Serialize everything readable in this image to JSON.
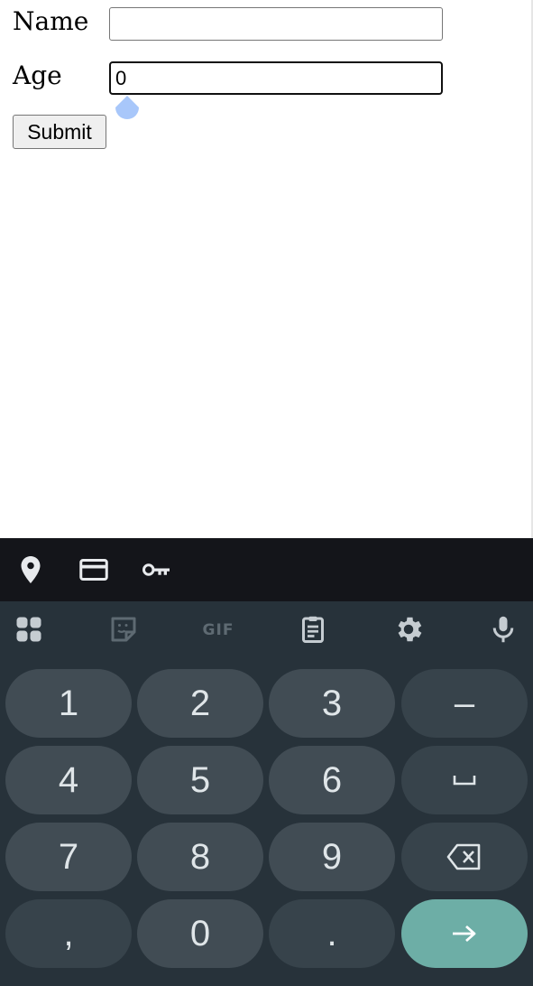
{
  "form": {
    "name_label": "Name",
    "name_value": "",
    "age_label": "Age",
    "age_value": "0",
    "submit_label": "Submit"
  },
  "autofill_bar": {
    "icons": [
      "location-pin-icon",
      "credit-card-icon",
      "key-icon"
    ]
  },
  "keyboard_toolbar": {
    "icons": [
      "apps-grid-icon",
      "sticker-icon",
      "gif-icon",
      "clipboard-icon",
      "gear-icon",
      "mic-icon"
    ],
    "gif_label": "GIF"
  },
  "keypad": {
    "keys": {
      "k1": "1",
      "k2": "2",
      "k3": "3",
      "dash": "–",
      "k4": "4",
      "k5": "5",
      "k6": "6",
      "k7": "7",
      "k8": "8",
      "k9": "9",
      "comma": ",",
      "k0": "0",
      "period": "."
    },
    "special_keys": [
      "space-icon",
      "backspace-icon",
      "enter-arrow-icon"
    ]
  },
  "colors": {
    "keyboard_bg": "#27323a",
    "key_bg": "#414c54",
    "enter_key_bg": "#6daea6",
    "autofill_bar_bg": "#14151a",
    "caret_handle": "#a8c7fa"
  }
}
